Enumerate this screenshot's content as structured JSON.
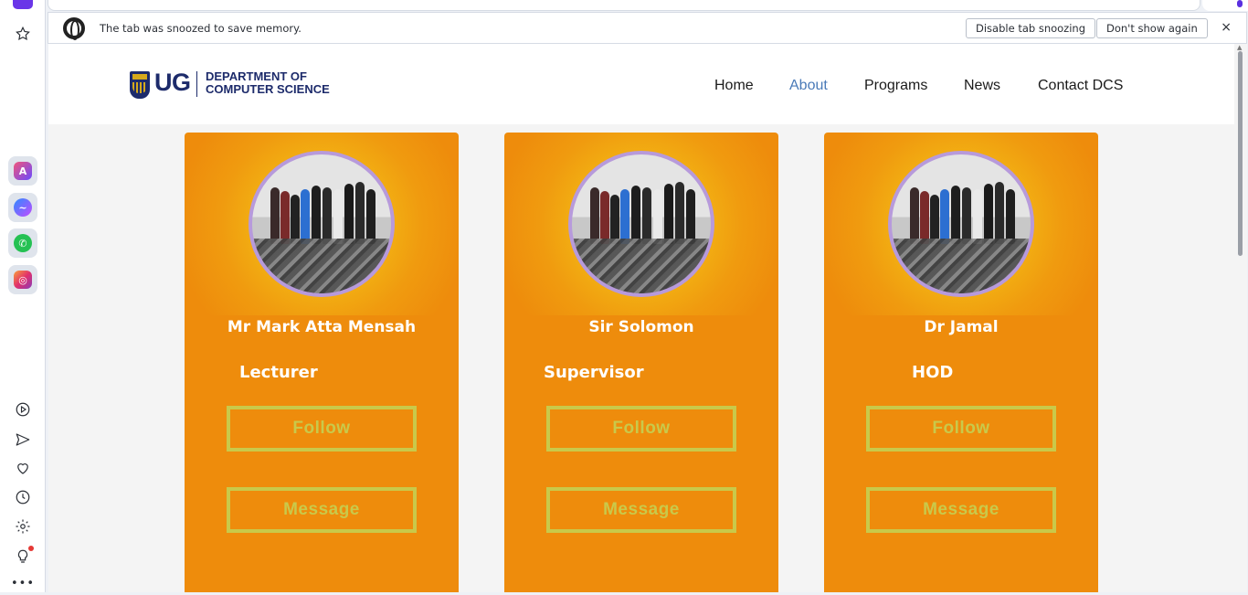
{
  "browser": {
    "notification": {
      "text": "The tab was snoozed to save memory.",
      "disable_button": "Disable tab snoozing",
      "dismiss_button": "Don't show again",
      "close_label": "×"
    },
    "sidebar": {
      "icons": [
        "bookmarks-icon",
        "aria-icon",
        "messenger-icon",
        "whatsapp-icon",
        "instagram-icon",
        "player-icon",
        "send-icon",
        "heart-icon",
        "history-icon",
        "settings-icon",
        "lightbulb-icon",
        "more-icon"
      ],
      "more_label": "•••"
    }
  },
  "site": {
    "logo": {
      "short": "UG",
      "line1": "DEPARTMENT OF",
      "line2": "COMPUTER SCIENCE"
    },
    "nav": [
      {
        "label": "Home",
        "active": false
      },
      {
        "label": "About",
        "active": true
      },
      {
        "label": "Programs",
        "active": false
      },
      {
        "label": "News",
        "active": false
      },
      {
        "label": "Contact DCS",
        "active": false
      }
    ]
  },
  "cards": [
    {
      "name": "Mr Mark Atta Mensah",
      "role": "Lecturer",
      "follow": "Follow",
      "message": "Message"
    },
    {
      "name": "Sir Solomon",
      "role": "Supervisor",
      "follow": "Follow",
      "message": "Message"
    },
    {
      "name": "Dr Jamal",
      "role": "HOD",
      "follow": "Follow",
      "message": "Message"
    }
  ],
  "colors": {
    "card_orange": "#ee8c0c",
    "card_glow": "#f6d21c",
    "button_outline": "#c9c94a",
    "nav_active": "#4a7ab8",
    "brand_navy": "#1d2b6b"
  }
}
